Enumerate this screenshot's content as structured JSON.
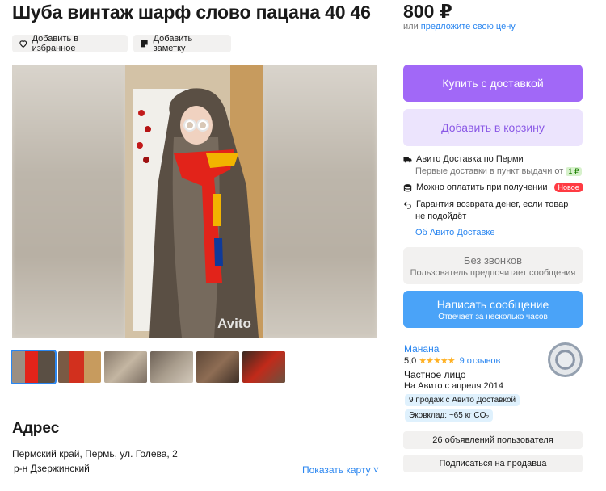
{
  "listing": {
    "title": "Шуба винтаж шарф слово пацана 40 46",
    "favorite_label": "Добавить в избранное",
    "note_label": "Добавить заметку",
    "watermark": "Avito"
  },
  "price": {
    "value": "800 ₽",
    "offer_prefix": "или",
    "offer_link": "предложите свою цену"
  },
  "buttons": {
    "buy": "Купить с доставкой",
    "cart": "Добавить в корзину"
  },
  "delivery": {
    "line1": "Авито Доставка по Перми",
    "line1_sub": "Первые доставки в пункт выдачи от",
    "price_badge": "1 ₽",
    "line2": "Можно оплатить при получении",
    "new_badge": "Новое",
    "line3": "Гарантия возврата денег, если товар",
    "line3_cont": "не подойдёт",
    "about_link": "Об Авито Доставке"
  },
  "contact": {
    "no_calls": "Без звонков",
    "no_calls_sub": "Пользователь предпочитает сообщения",
    "write": "Написать сообщение",
    "write_sub": "Отвечает за несколько часов"
  },
  "seller": {
    "name": "Манана",
    "rating": "5,0",
    "stars": "★★★★★",
    "reviews": "9 отзывов",
    "type": "Частное лицо",
    "since": "На Авито с апреля 2014",
    "chip1": "9 продаж с Авито Доставкой",
    "chip2": "Эковклад: ~65 кг CO₂",
    "ads_button": "26 объявлений пользователя",
    "subscribe_button": "Подписаться на продавца"
  },
  "address": {
    "heading": "Адрес",
    "line1": "Пермский край, Пермь, ул. Голева, 2",
    "line2": "р-н Дзержинский",
    "map_link": "Показать карту ˅"
  },
  "icons": [
    "heart-icon",
    "note-icon",
    "truck-icon",
    "coins-icon",
    "return-icon"
  ],
  "colors": {
    "accent_purple": "#a168f7",
    "accent_blue": "#4aa3f8",
    "link_blue": "#2a86f0"
  }
}
